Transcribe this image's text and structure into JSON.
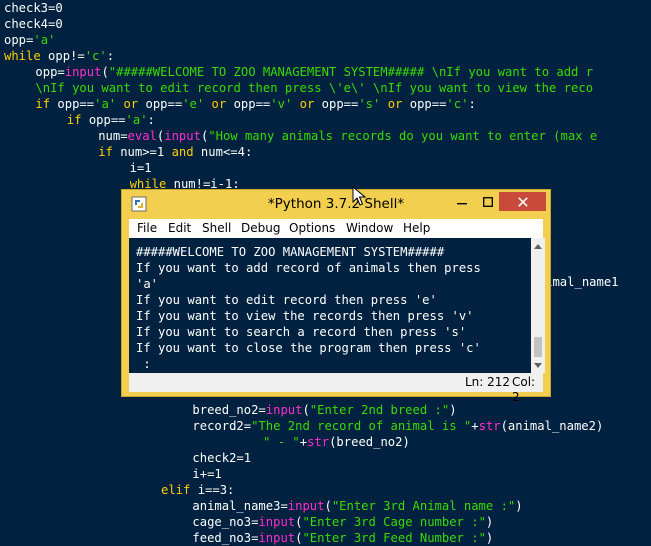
{
  "editor": {
    "lines": [
      {
        "indent": 0,
        "tokens": [
          {
            "t": "check3=0",
            "k": "plain"
          }
        ]
      },
      {
        "indent": 0,
        "tokens": [
          {
            "t": "check4=0",
            "k": "plain"
          }
        ]
      },
      {
        "indent": 0,
        "tokens": [
          {
            "t": "opp=",
            "k": "plain"
          },
          {
            "t": "'a'",
            "k": "str"
          }
        ]
      },
      {
        "indent": 0,
        "tokens": [
          {
            "t": "while",
            "k": "kw"
          },
          {
            "t": " opp!=",
            "k": "plain"
          },
          {
            "t": "'c'",
            "k": "str"
          },
          {
            "t": ":",
            "k": "plain"
          }
        ]
      },
      {
        "indent": 4,
        "tokens": [
          {
            "t": "opp=",
            "k": "plain"
          },
          {
            "t": "input",
            "k": "bi"
          },
          {
            "t": "(",
            "k": "plain"
          },
          {
            "t": "\"#####WELCOME TO ZOO MANAGEMENT SYSTEM##### \\nIf you want to add r",
            "k": "str"
          }
        ]
      },
      {
        "indent": 4,
        "tokens": [
          {
            "t": "\\nIf you want to edit record then press \\'e\\' \\nIf you want to view the reco",
            "k": "str"
          }
        ]
      },
      {
        "indent": 4,
        "tokens": [
          {
            "t": "if",
            "k": "kw"
          },
          {
            "t": " opp==",
            "k": "plain"
          },
          {
            "t": "'a'",
            "k": "str"
          },
          {
            "t": " ",
            "k": "plain"
          },
          {
            "t": "or",
            "k": "kw"
          },
          {
            "t": " opp==",
            "k": "plain"
          },
          {
            "t": "'e'",
            "k": "str"
          },
          {
            "t": " ",
            "k": "plain"
          },
          {
            "t": "or",
            "k": "kw"
          },
          {
            "t": " opp==",
            "k": "plain"
          },
          {
            "t": "'v'",
            "k": "str"
          },
          {
            "t": " ",
            "k": "plain"
          },
          {
            "t": "or",
            "k": "kw"
          },
          {
            "t": " opp==",
            "k": "plain"
          },
          {
            "t": "'s'",
            "k": "str"
          },
          {
            "t": " ",
            "k": "plain"
          },
          {
            "t": "or",
            "k": "kw"
          },
          {
            "t": " opp==",
            "k": "plain"
          },
          {
            "t": "'c'",
            "k": "str"
          },
          {
            "t": ":",
            "k": "plain"
          }
        ]
      },
      {
        "indent": 8,
        "tokens": [
          {
            "t": "if",
            "k": "kw"
          },
          {
            "t": " opp==",
            "k": "plain"
          },
          {
            "t": "'a'",
            "k": "str"
          },
          {
            "t": ":",
            "k": "plain"
          }
        ]
      },
      {
        "indent": 12,
        "tokens": [
          {
            "t": "num=",
            "k": "plain"
          },
          {
            "t": "eval",
            "k": "bi"
          },
          {
            "t": "(",
            "k": "plain"
          },
          {
            "t": "input",
            "k": "bi"
          },
          {
            "t": "(",
            "k": "plain"
          },
          {
            "t": "\"How many animals records do you want to enter (max e",
            "k": "str"
          }
        ]
      },
      {
        "indent": 12,
        "tokens": [
          {
            "t": "if",
            "k": "kw"
          },
          {
            "t": " num>=1 ",
            "k": "plain"
          },
          {
            "t": "and",
            "k": "kw"
          },
          {
            "t": " num<=4:",
            "k": "plain"
          }
        ]
      },
      {
        "indent": 16,
        "tokens": [
          {
            "t": "i=1",
            "k": "plain"
          }
        ]
      },
      {
        "indent": 16,
        "tokens": [
          {
            "t": "while",
            "k": "kw"
          },
          {
            "t": " num!=i-1:",
            "k": "plain"
          }
        ]
      },
      {
        "indent": 68,
        "tokens": [
          {
            "t": "nimal_name1",
            "k": "plain"
          }
        ]
      },
      {
        "indent": 24,
        "tokens": [
          {
            "t": "breed_no2=",
            "k": "plain"
          },
          {
            "t": "input",
            "k": "bi"
          },
          {
            "t": "(",
            "k": "plain"
          },
          {
            "t": "\"Enter 2nd breed :\"",
            "k": "str"
          },
          {
            "t": ")",
            "k": "plain"
          }
        ]
      },
      {
        "indent": 24,
        "tokens": [
          {
            "t": "record2=",
            "k": "plain"
          },
          {
            "t": "\"The 2nd record of animal is \"",
            "k": "str"
          },
          {
            "t": "+",
            "k": "plain"
          },
          {
            "t": "str",
            "k": "bi"
          },
          {
            "t": "(animal_name2)",
            "k": "plain"
          }
        ]
      },
      {
        "indent": 33,
        "tokens": [
          {
            "t": "\" - \"",
            "k": "str"
          },
          {
            "t": "+",
            "k": "plain"
          },
          {
            "t": "str",
            "k": "bi"
          },
          {
            "t": "(breed_no2)",
            "k": "plain"
          }
        ]
      },
      {
        "indent": 24,
        "tokens": [
          {
            "t": "check2=1",
            "k": "plain"
          }
        ]
      },
      {
        "indent": 24,
        "tokens": [
          {
            "t": "i+=1",
            "k": "plain"
          }
        ]
      },
      {
        "indent": 20,
        "tokens": [
          {
            "t": "elif",
            "k": "kw"
          },
          {
            "t": " i==3:",
            "k": "plain"
          }
        ]
      },
      {
        "indent": 24,
        "tokens": [
          {
            "t": "animal_name3=",
            "k": "plain"
          },
          {
            "t": "input",
            "k": "bi"
          },
          {
            "t": "(",
            "k": "plain"
          },
          {
            "t": "\"Enter 3rd Animal name :\"",
            "k": "str"
          },
          {
            "t": ")",
            "k": "plain"
          }
        ]
      },
      {
        "indent": 24,
        "tokens": [
          {
            "t": "cage_no3=",
            "k": "plain"
          },
          {
            "t": "input",
            "k": "bi"
          },
          {
            "t": "(",
            "k": "plain"
          },
          {
            "t": "\"Enter 3rd Cage number :\"",
            "k": "str"
          },
          {
            "t": ")",
            "k": "plain"
          }
        ]
      },
      {
        "indent": 24,
        "tokens": [
          {
            "t": "feed_no3=",
            "k": "plain"
          },
          {
            "t": "input",
            "k": "bi"
          },
          {
            "t": "(",
            "k": "plain"
          },
          {
            "t": "\"Enter 3rd Feed Number :\"",
            "k": "str"
          },
          {
            "t": ")",
            "k": "plain"
          }
        ]
      }
    ]
  },
  "shell": {
    "title": "*Python 3.7.2 Shell*",
    "menu": [
      "File",
      "Edit",
      "Shell",
      "Debug",
      "Options",
      "Window",
      "Help"
    ],
    "output": [
      "#####WELCOME TO ZOO MANAGEMENT SYSTEM#####",
      "If you want to add record of animals then press",
      "'a'",
      "If you want to edit record then press 'e'",
      "If you want to view the records then press 'v'",
      "If you want to search a record then press 's'",
      "If you want to close the program then press 'c'",
      " :"
    ],
    "status_line": "Ln: 212",
    "status_col": "Col: 2",
    "icons": {
      "app": "python-idle-icon",
      "minimize": "minimize-icon",
      "maximize": "maximize-icon",
      "close": "close-icon",
      "cursor": "mouse-cursor-icon"
    }
  },
  "colors": {
    "background": "#002240",
    "text": "#ffffff",
    "keyword": "#ffd000",
    "string": "#3ad900",
    "builtin": "#ff2ed0",
    "window_frame": "#f2cf4e",
    "close_button": "#c74a3a"
  }
}
